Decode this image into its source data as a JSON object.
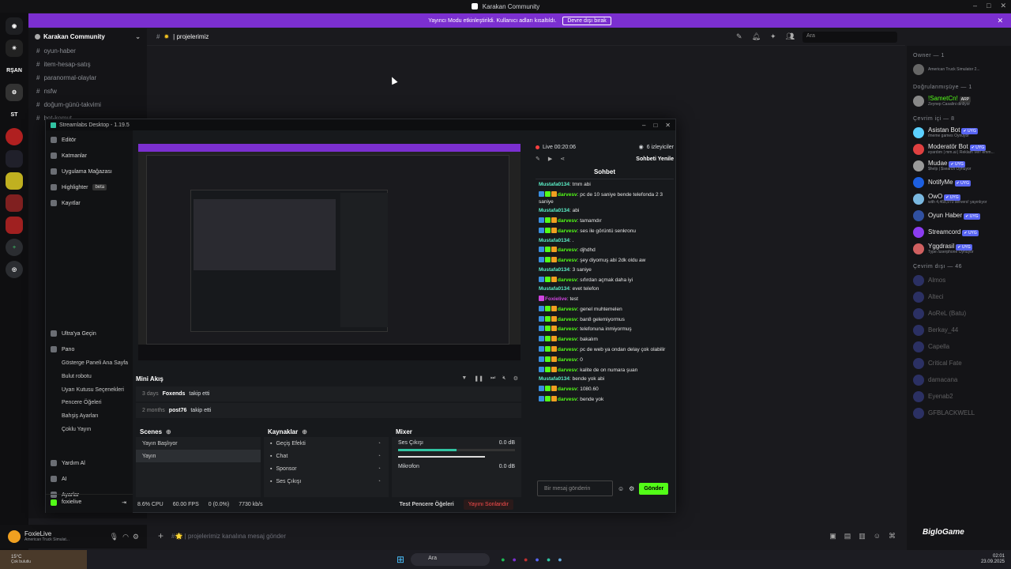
{
  "titlebar": {
    "title": "Karakan Community"
  },
  "banner": {
    "text": "Yayıncı Modu etkinleştirildi. Kullanıcı adları kısaltıldı.",
    "button": "Devre dışı bırak"
  },
  "guilds": [
    "RŞAN",
    "ST"
  ],
  "server": {
    "name": "Karakan Community"
  },
  "channels": [
    "oyun-haber",
    "item-hesap-satış",
    "paranormal-olaylar",
    "nsfw",
    "doğum-günü-takvimi",
    "bot-komut"
  ],
  "header": {
    "channel": "projelerimiz",
    "search_placeholder": "Ara"
  },
  "composer": {
    "placeholder": "#🌟 | projelerimiz kanalına mesaj gönder"
  },
  "user": {
    "name": "FoxieLive",
    "status": "American Truck Simulat..."
  },
  "members": {
    "owner_cat": "Owner — 1",
    "owner": {
      "status": "American Truck Simulator 2..."
    },
    "verified_cat": "Doğrulanmışüye — 1",
    "verified": {
      "name": "!SametCn!",
      "tag": "ARP",
      "status": "Zeynep Casalini dinliyor"
    },
    "online_cat": "Çevrim içi — 8",
    "online": [
      {
        "name": "Asistan Bot",
        "sub": "/meme games Oynuyor",
        "color": "#5cd0ff"
      },
      {
        "name": "Moderatör Bot",
        "sub": "eyardım | mm.ai | Reklam Ver! emm...",
        "color": "#e04040"
      },
      {
        "name": "Mudae",
        "sub": "$help | $search Oynuyor",
        "color": "#9a9a9a"
      },
      {
        "name": "NotifyMe",
        "sub": "",
        "color": "#1d5fe0"
      },
      {
        "name": "OwO",
        "sub": "with 4,468,970 servers! yayınlıyor",
        "color": "#7ab8e0"
      },
      {
        "name": "Oyun Haber",
        "sub": "",
        "color": "#3050a0"
      },
      {
        "name": "Streamcord",
        "sub": "",
        "color": "#8b3cf0"
      },
      {
        "name": "Yggdrasil",
        "sub": "Type /userphone Oynuyor",
        "color": "#d06060"
      }
    ],
    "offline_cat": "Çevrim dışı — 46",
    "offline": [
      "Almos",
      "Alteci",
      "AoReL (Batu)",
      "Berkay_44",
      "Capella",
      "Critical Fate",
      "damacana",
      "Eyenab2",
      "GFBLACKWELL"
    ],
    "app_badge": "BigloGame"
  },
  "taskbar": {
    "search": "Ara",
    "weather": "15°C",
    "weather_sub": "Çok bulutlu",
    "time": "02:01",
    "date": "23.09.2025"
  },
  "streamlabs": {
    "title": "Streamlabs Desktop - 1.19.5",
    "nav": [
      "Editör",
      "Katmanlar",
      "Uygulama Mağazası",
      "Highlighter",
      "Kayıtlar"
    ],
    "beta": "beta",
    "nav2": [
      "Ultra'ya Geçin",
      "Pano"
    ],
    "subnav": [
      "Gösterge Paneli Ana Sayfa",
      "Bulut robotu",
      "Uyarı Kutusu Seçenekleri",
      "Pencere Öğeleri",
      "Bahşiş Ayarları",
      "Çoklu Yayın"
    ],
    "nav3": [
      "Yardım Al",
      "AI",
      "Ayarlar"
    ],
    "account": "foxielive",
    "mini_title": "Mini Akış",
    "activity": [
      {
        "time": "3 days",
        "user": "Foxends",
        "action": "takip etti"
      },
      {
        "time": "2 months",
        "user": "post76",
        "action": "takip etti"
      }
    ],
    "scenes_title": "Scenes",
    "scenes": [
      "Yayın Başlıyor",
      "Yayın"
    ],
    "sources_title": "Kaynaklar",
    "sources": [
      "Geçiş Efekti",
      "Chat",
      "Sponsor",
      "Ses Çıkışı"
    ],
    "mixer_title": "Mixer",
    "mixer": [
      {
        "name": "Ses Çıkışı",
        "db": "0.0 dB"
      },
      {
        "name": "Mikrofon",
        "db": "0.0 dB"
      }
    ],
    "status": {
      "cpu": "8.6% CPU",
      "fps": "60.00 FPS",
      "dropped": "0 (0.0%)",
      "bitrate": "7730 kb/s",
      "test": "Test Pencere Öğeleri",
      "end": "Yayını Sonlandır"
    },
    "chat": {
      "live": "Live 00:20:06",
      "viewers": "6 izleyiciler",
      "refresh": "Sohbeti Yenile",
      "title": "Sohbet",
      "input_placeholder": "Bir mesaj gönderin",
      "send": "Gönder",
      "messages": [
        {
          "user": "Mustafa0134",
          "text": "tmm abi",
          "badges": 0,
          "style": "nm2"
        },
        {
          "user": "darvesv",
          "text": "pc de 10 saniye bende telefonda 2 3 saniye",
          "badges": 3,
          "style": "nm1"
        },
        {
          "user": "Mustafa0134",
          "text": "abi",
          "badges": 0,
          "style": "nm2"
        },
        {
          "user": "darvesv",
          "text": "tamamdır",
          "badges": 3,
          "style": "nm1"
        },
        {
          "user": "darvesv",
          "text": "ses ile görüntü senkronu",
          "badges": 3,
          "style": "nm1"
        },
        {
          "user": "Mustafa0134",
          "text": ".",
          "badges": 0,
          "style": "nm2"
        },
        {
          "user": "darvesv",
          "text": "djhdhd",
          "badges": 3,
          "style": "nm1"
        },
        {
          "user": "darvesv",
          "text": "şey diyomuş abi 2dk oldu aw",
          "badges": 3,
          "style": "nm1"
        },
        {
          "user": "Mustafa0134",
          "text": "3 saniye",
          "badges": 0,
          "style": "nm2"
        },
        {
          "user": "darvesv",
          "text": "sıfırdan açmak daha iyi",
          "badges": 3,
          "style": "nm1"
        },
        {
          "user": "Mustafa0134",
          "text": "evet telefon",
          "badges": 0,
          "style": "nm2"
        },
        {
          "user": "Foxielive",
          "text": "test",
          "badges": 1,
          "style": "nm3"
        },
        {
          "user": "darvesv",
          "text": "genel muhtemelen",
          "badges": 3,
          "style": "nm1"
        },
        {
          "user": "darvesv",
          "text": "ban8 gelemiyormus",
          "badges": 3,
          "style": "nm1"
        },
        {
          "user": "darvesv",
          "text": "telefonuna inmiyormuş",
          "badges": 3,
          "style": "nm1"
        },
        {
          "user": "darvesv",
          "text": "bakalım",
          "badges": 3,
          "style": "nm1"
        },
        {
          "user": "darvesv",
          "text": "pc de web ya ondan delay çok olabilir",
          "badges": 3,
          "style": "nm1"
        },
        {
          "user": "darvesv",
          "text": "0",
          "badges": 3,
          "style": "nm1"
        },
        {
          "user": "darvesv",
          "text": "kalite de on numara şuan",
          "badges": 3,
          "style": "nm1"
        },
        {
          "user": "Mustafa0134",
          "text": "bende yok abi",
          "badges": 0,
          "style": "nm2"
        },
        {
          "user": "darvesv",
          "text": "1080.60",
          "badges": 3,
          "style": "nm1"
        },
        {
          "user": "darvesv",
          "text": "bende yok",
          "badges": 3,
          "style": "nm1"
        }
      ]
    }
  }
}
